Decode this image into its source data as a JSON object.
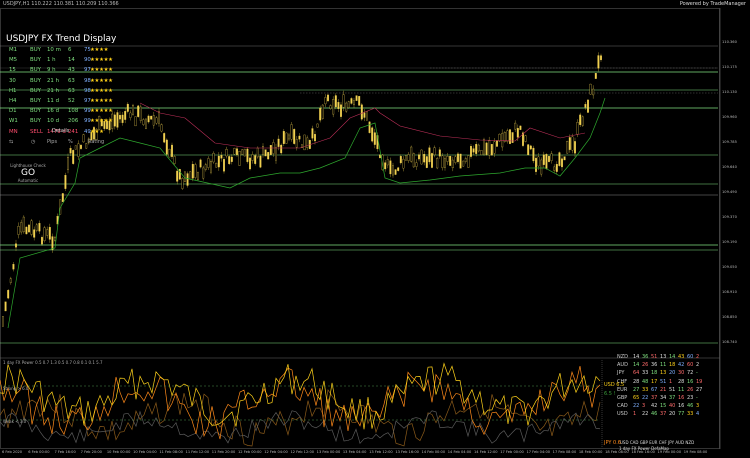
{
  "window": {
    "symbol_title": "USDJPY,H1 110.222 110.381 110.209 110.366",
    "plugin": "Powered by TradeManager"
  },
  "trend_display": {
    "title": "USDJPY FX Trend Display",
    "rows": [
      {
        "tf": "M1",
        "dir": "BUY",
        "dur": "10 m",
        "a": "6",
        "b": "75",
        "stars": "★★★★",
        "color": "#7fe07f"
      },
      {
        "tf": "M5",
        "dir": "BUY",
        "dur": "1 h",
        "a": "14",
        "b": "90",
        "stars": "★★★★★",
        "color": "#7fe07f"
      },
      {
        "tf": "15",
        "dir": "BUY",
        "dur": "9 h",
        "a": "43",
        "b": "97",
        "stars": "★★★★★",
        "color": "#7fe07f"
      },
      {
        "tf": "30",
        "dir": "BUY",
        "dur": "21 h",
        "a": "63",
        "b": "98",
        "stars": "★★★★★",
        "color": "#7fe07f"
      },
      {
        "tf": "H1",
        "dir": "BUY",
        "dur": "21 h",
        "a": "63",
        "b": "98",
        "stars": "★★★★★",
        "color": "#7fe07f"
      },
      {
        "tf": "H4",
        "dir": "BUY",
        "dur": "11 d",
        "a": "52",
        "b": "97",
        "stars": "★★★★★",
        "color": "#7fe07f"
      },
      {
        "tf": "D1",
        "dir": "BUY",
        "dur": "16 d",
        "a": "108",
        "b": "99",
        "stars": "★★★★★",
        "color": "#7fe07f"
      },
      {
        "tf": "W1",
        "dir": "BUY",
        "dur": "10 d",
        "a": "206",
        "b": "99",
        "stars": "★★★★★",
        "color": "#7fe07f"
      },
      {
        "tf": "MN",
        "dir": "SELL",
        "dur": "1479 d",
        "a": "241",
        "b": "49",
        "stars": "★★★",
        "color": "#ff4d6d"
      }
    ],
    "footer": [
      "⇆",
      "◷",
      "Pips",
      "%",
      "Rating"
    ],
    "details_label": "Details"
  },
  "lighthouse": {
    "caption": "Lighthouse Check",
    "status": "GO",
    "mode": "Automatic"
  },
  "price_axis": [
    "110.360",
    "110.175",
    "110.130",
    "109.960",
    "109.785",
    "109.640",
    "109.490",
    "109.370",
    "109.190",
    "109.050",
    "108.910",
    "108.850",
    "108.740"
  ],
  "time_axis": [
    "6 Feb 2020",
    "6 Feb 00:00",
    "7 Feb 16:00",
    "7 Feb 20:00",
    "10 Feb 00:00",
    "10 Feb 04:00",
    "11 Feb 08:00",
    "11 Feb 12:00",
    "11 Feb 20:00",
    "12 Feb 00:00",
    "12 Feb 04:00",
    "12 Feb 12:00",
    "13 Feb 00:00",
    "13 Feb 04:00",
    "13 Feb 12:00",
    "13 Feb 16:00",
    "14 Feb 00:00",
    "14 Feb 04:00",
    "14 Feb 12:00",
    "17 Feb 00:00",
    "17 Feb 04:00",
    "17 Feb 08:00",
    "18 Feb 00:00",
    "18 Feb 08:00",
    "18 Feb 16:00",
    "19 Feb 00:00",
    "19 Feb 08:00"
  ],
  "power_panel": {
    "title": "1 day FX Power 0.5 0.7 1.3 0.5 0.7 0.8 0.1 0.1 5.7",
    "strong_label": "Strong > 6.0",
    "weak_label": "Weak < 3.0"
  },
  "meter": {
    "header": [
      "",
      "",
      "",
      "",
      "",
      "",
      "",
      ""
    ],
    "rows": [
      {
        "ccy": "NZD",
        "vals": [
          "14",
          "36",
          "51",
          "13",
          "14",
          "43",
          "60",
          "2"
        ]
      },
      {
        "ccy": "AUD",
        "vals": [
          "14",
          "26",
          "36",
          "11",
          "18",
          "42",
          "60",
          "2"
        ]
      },
      {
        "ccy": "JPY",
        "vals": [
          "64",
          "33",
          "18",
          "13",
          "20",
          "30",
          "72",
          "-"
        ]
      },
      {
        "ccy": "CHF",
        "vals": [
          "28",
          "48",
          "17",
          "51",
          "1",
          "28",
          "16",
          "19"
        ]
      },
      {
        "ccy": "EUR",
        "vals": [
          "27",
          "33",
          "67",
          "21",
          "51",
          "11",
          "26",
          "27"
        ]
      },
      {
        "ccy": "GBP",
        "vals": [
          "65",
          "22",
          "37",
          "34",
          "37",
          "16",
          "23",
          "-"
        ]
      },
      {
        "ccy": "CAD",
        "vals": [
          "22",
          "3",
          "42",
          "15",
          "40",
          "16",
          "46",
          "3"
        ]
      },
      {
        "ccy": "USD",
        "vals": [
          "1",
          "22",
          "46",
          "37",
          "20",
          "77",
          "33",
          "4"
        ]
      }
    ],
    "bottom_ccys": "USD CAD GBP EUR CHF JPY AUD NZD",
    "footer": "1 day    FX Power    DefaMap",
    "labels": [
      {
        "text": "USD 6.5",
        "color": "#ffd21a"
      },
      {
        "text": "6.5 !",
        "color": "#3c9d3c"
      },
      {
        "text": "JPY 0.6",
        "color": "#ff8a1a"
      }
    ]
  },
  "colors": {
    "bull": "#f0d050",
    "bear": "#c8b040",
    "support": "#2ea82e",
    "resistance": "#c0305a",
    "level": "#7fe07f",
    "usd": "#ffd21a",
    "jpy": "#ff8a1a",
    "weak": "#4d8f4d"
  }
}
